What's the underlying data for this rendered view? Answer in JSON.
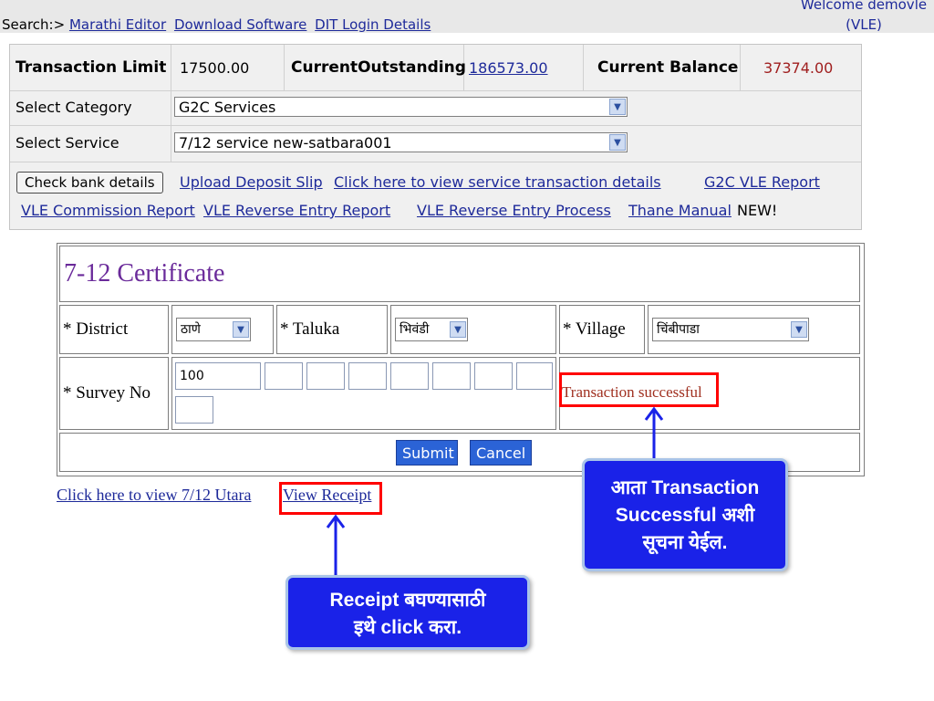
{
  "topbar": {
    "search_label": "Search:>",
    "links": [
      "Marathi Editor",
      "Download Software",
      "DIT Login Details"
    ],
    "welcome_line1": "Welcome demovle",
    "welcome_line2": "(VLE)"
  },
  "info": {
    "transaction_limit_label": "Transaction Limit",
    "transaction_limit_value": "17500.00",
    "current_outstanding_label": "CurrentOutstanding",
    "current_outstanding_value": "186573.00",
    "current_balance_label": "Current Balance",
    "current_balance_value": "37374.00",
    "select_category_label": "Select Category",
    "select_category_value": "G2C Services",
    "select_service_label": "Select Service",
    "select_service_value": "7/12 service new-satbara001",
    "check_bank_button": "Check bank details",
    "links_row1": [
      "Upload Deposit Slip",
      "Click here to view service transaction details",
      "G2C VLE Report"
    ],
    "links_row2": [
      "VLE Commission Report",
      "VLE Reverse Entry Report",
      "VLE Reverse Entry Process",
      "Thane Manual"
    ],
    "new_badge": "NEW!"
  },
  "cert": {
    "title": "7-12 Certificate",
    "district_label": "* District",
    "district_value": "ठाणे",
    "taluka_label": "* Taluka",
    "taluka_value": "भिवंडी",
    "village_label": "* Village",
    "village_value": "चिंबीपाडा",
    "survey_label": "* Survey No",
    "survey_value": "100",
    "status_message": "Transaction successful",
    "submit_button": "Submit",
    "cancel_button": "Cancel"
  },
  "links": {
    "view_utara": "Click here to view 7/12 Utara",
    "view_receipt": "View Receipt"
  },
  "callouts": {
    "transaction_line1": "आता  Transaction",
    "transaction_line2": "Successful अशी",
    "transaction_line3": "सूचना  येईल.",
    "receipt_line1": "Receipt बघण्यासाठी",
    "receipt_line2": "इथे  click करा."
  },
  "colors": {
    "link": "#1e2a9a",
    "balance": "#a02020",
    "status": "#a03020",
    "highlight": "#ff0000",
    "callout_bg": "#1a22e8"
  }
}
